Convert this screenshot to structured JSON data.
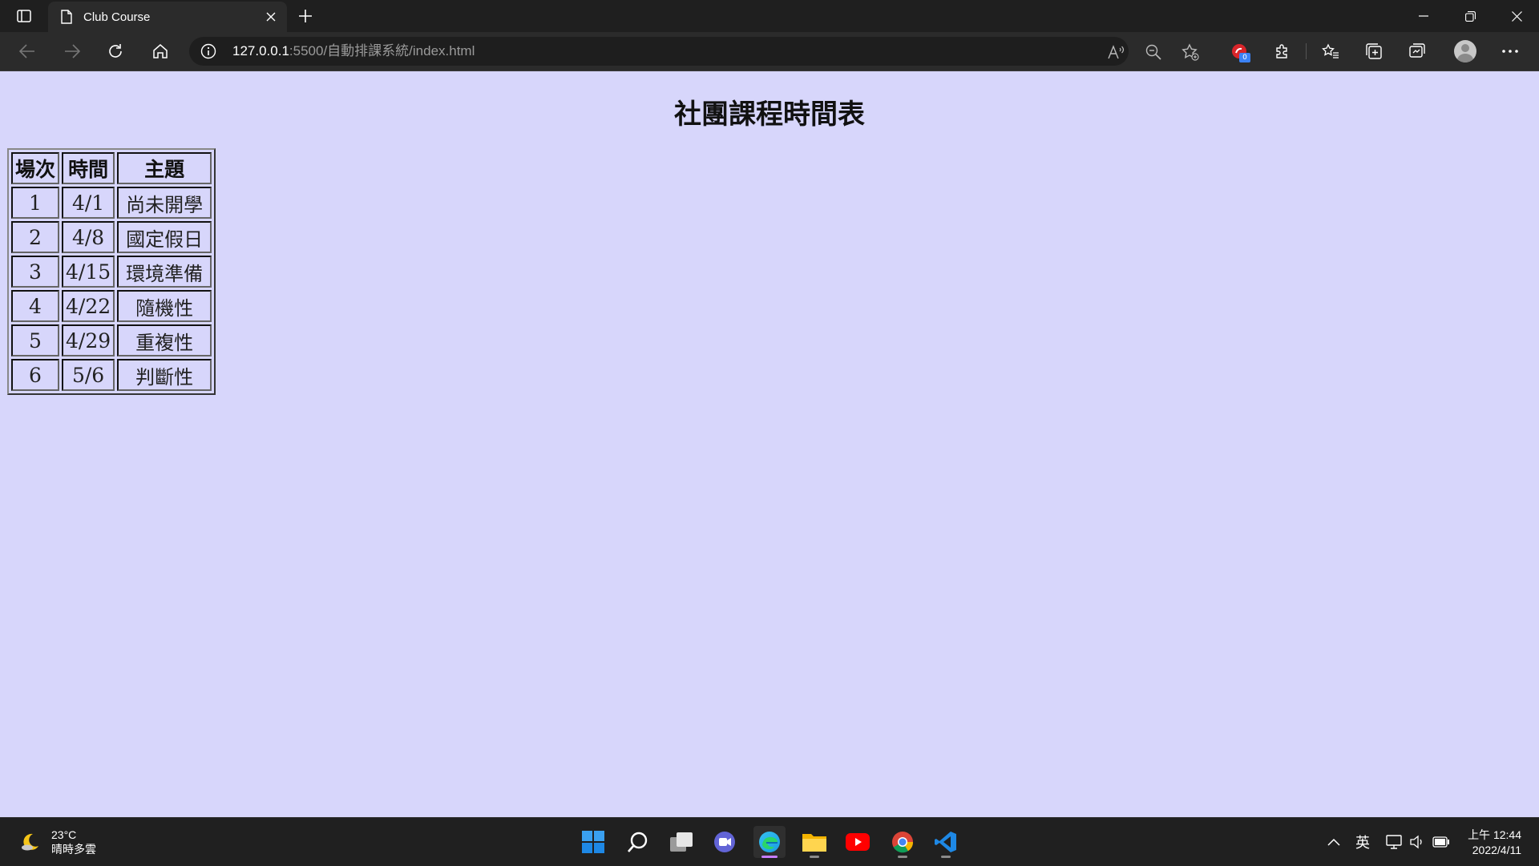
{
  "browser": {
    "tab_title": "Club Course",
    "url_host": "127.0.0.1",
    "url_rest": ":5500/自動排課系統/index.html",
    "extension_badge": "0"
  },
  "page": {
    "title": "社團課程時間表",
    "table": {
      "headers": [
        "場次",
        "時間",
        "主題"
      ],
      "rows": [
        {
          "num": "1",
          "date": "4/1",
          "topic": "尚未開學"
        },
        {
          "num": "2",
          "date": "4/8",
          "topic": "國定假日"
        },
        {
          "num": "3",
          "date": "4/15",
          "topic": "環境準備"
        },
        {
          "num": "4",
          "date": "4/22",
          "topic": "隨機性"
        },
        {
          "num": "5",
          "date": "4/29",
          "topic": "重複性"
        },
        {
          "num": "6",
          "date": "5/6",
          "topic": "判斷性"
        }
      ]
    }
  },
  "taskbar": {
    "weather_temp": "23°C",
    "weather_desc": "晴時多雲",
    "input_lang": "英",
    "time": "上午 12:44",
    "date": "2022/4/11"
  },
  "colors": {
    "page_background": "#d7d6fb",
    "chrome_dark": "#1f1f1f",
    "taskbar": "#202020"
  }
}
